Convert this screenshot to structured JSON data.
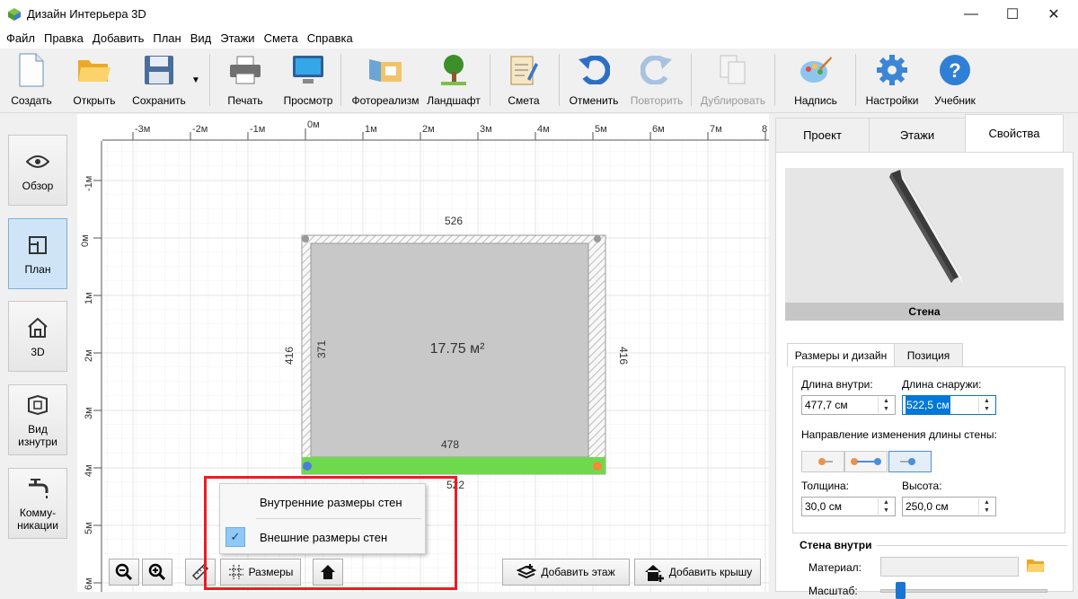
{
  "window": {
    "title": "Дизайн Интерьера 3D",
    "minimize_glyph": "—",
    "maximize_glyph": "☐",
    "close_glyph": "✕"
  },
  "menu": [
    "Файл",
    "Правка",
    "Добавить",
    "План",
    "Вид",
    "Этажи",
    "Смета",
    "Справка"
  ],
  "toolbar": {
    "create": "Создать",
    "open": "Открыть",
    "save": "Сохранить",
    "print": "Печать",
    "preview": "Просмотр",
    "photorealism": "Фотореализм",
    "landscape": "Ландшафт",
    "estimate": "Смета",
    "undo": "Отменить",
    "redo": "Повторить",
    "duplicate": "Дублировать",
    "caption": "Надпись",
    "settings": "Настройки",
    "tutorial": "Учебник"
  },
  "sidebar": {
    "overview": "Обзор",
    "plan": "План",
    "view3d": "3D",
    "inside_view": "Вид изнутри",
    "utilities": "Комму-никации"
  },
  "ruler": {
    "h": [
      "-3м",
      "-2м",
      "-1м",
      "0м",
      "1м",
      "2м",
      "3м",
      "4м",
      "5м",
      "6м",
      "7м",
      "8"
    ],
    "v": [
      "-1м",
      "0м",
      "1м",
      "2м",
      "3м",
      "4м",
      "5м",
      "6м"
    ]
  },
  "plan": {
    "dim_top": "526",
    "dim_left_outer": "416",
    "dim_left_inner": "371",
    "dim_right": "416",
    "dim_bottom_inner": "478",
    "dim_bottom_outer": "522",
    "area": "17.75 м²",
    "wall_color": "#6fd94e"
  },
  "popup": {
    "inner": "Внутренние размеры стен",
    "outer": "Внешние размеры стен",
    "check": "✓"
  },
  "bottom_bar": {
    "dimensions": "Размеры",
    "add_floor": "Добавить этаж",
    "add_roof": "Добавить крышу"
  },
  "right_panel": {
    "tabs": [
      "Проект",
      "Этажи",
      "Свойства"
    ],
    "preview_caption": "Стена",
    "inner_tabs": [
      "Размеры и дизайн",
      "Позиция"
    ],
    "length_inside_label": "Длина внутри:",
    "length_inside": "477,7 см",
    "length_outside_label": "Длина снаружи:",
    "length_outside": "522,5 см",
    "direction_label": "Направление изменения длины стены:",
    "thickness_label": "Толщина:",
    "thickness": "30,0 см",
    "height_label": "Высота:",
    "height": "250,0 см",
    "inside_section": "Стена внутри",
    "material_label": "Материал:",
    "scale_label": "Масштаб:",
    "scale_value": 0.12
  }
}
